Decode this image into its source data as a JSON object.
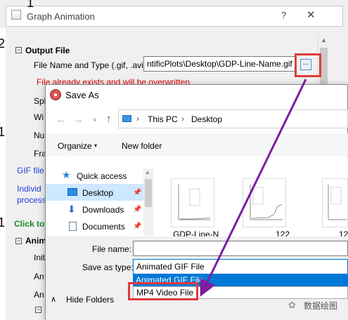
{
  "bg_window": {
    "title": "Graph Animation",
    "help_glyph": "?",
    "close_glyph": "✕",
    "margin_digits": [
      "1",
      "2",
      "1",
      "1"
    ],
    "output_file": {
      "heading": "Output File",
      "name_label": "File Name and Type (.gif, .avi)",
      "path_value": "ntificPlots\\Desktop\\GDP-Line-Name.gif",
      "browse_label": "...",
      "warning": "File already exists and will be overwritten"
    },
    "truncated": {
      "sp": "Spl",
      "wi": "Wi",
      "nu": "Nu",
      "fra": "Fra",
      "gif": "GIF file",
      "indiv": "Individ",
      "process": "process",
      "click": "Click to",
      "anim": "Anim",
      "ini": "Init",
      "an1": "An",
      "an2": "An"
    }
  },
  "save_as": {
    "title": "Save As",
    "nav": {
      "back": "←",
      "forward": "→",
      "recent": "∨",
      "up": "↑"
    },
    "breadcrumb": {
      "sep": "›",
      "this_pc": "This PC",
      "desktop": "Desktop"
    },
    "toolbar": {
      "organize": "Organize",
      "organize_caret": "▾",
      "new_folder": "New folder"
    },
    "nav_pane": {
      "quick_access": "Quick access",
      "desktop": "Desktop",
      "downloads": "Downloads",
      "documents": "Documents",
      "pin": "📌"
    },
    "files": [
      "GDP-Line-N",
      "122",
      "12"
    ],
    "filename_label": "File name:",
    "filename_value": "",
    "type_label": "Save as type:",
    "type_selected": "Animated GIF File",
    "type_options": [
      "Animated GIF File",
      "MP4 Video File"
    ],
    "hide_folders_caret": "∧",
    "hide_folders": "Hide Folders"
  },
  "watermark": {
    "icon": "✿",
    "text": "数据绘图"
  },
  "colors": {
    "highlight": "#e03a3a",
    "arrow": "#7a1fa2",
    "selection": "#0078d7"
  }
}
